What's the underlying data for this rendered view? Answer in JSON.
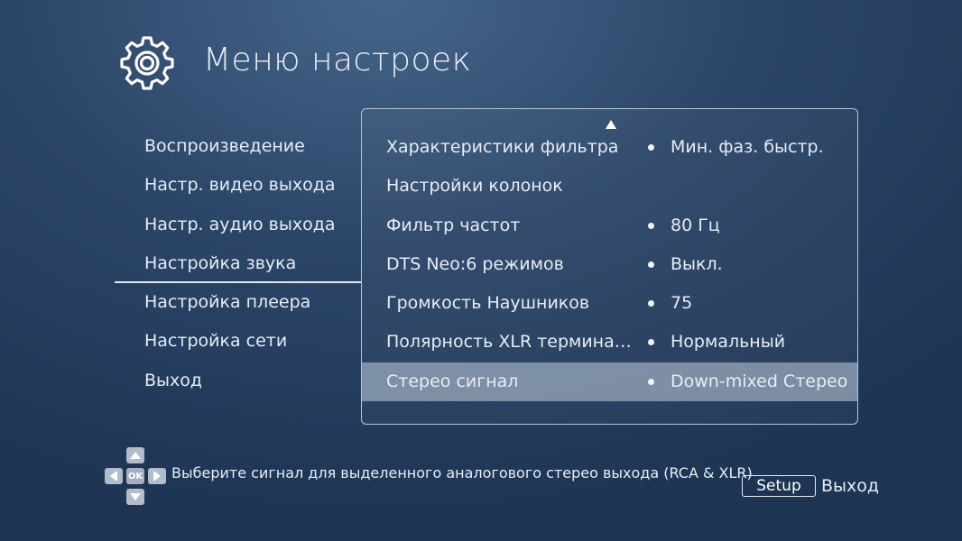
{
  "header": {
    "title": "Меню настроек",
    "icon": "gear-icon"
  },
  "sidebar": {
    "items": [
      {
        "label": "Воспроизведение"
      },
      {
        "label": "Настр. видео выхода"
      },
      {
        "label": "Настр. аудио выхода"
      },
      {
        "label": "Настройка звука"
      },
      {
        "label": "Настройка плеера"
      },
      {
        "label": "Настройка сети"
      },
      {
        "label": "Выход"
      }
    ],
    "active_index": 3
  },
  "panel": {
    "rows": [
      {
        "label": "Характеристики фильтра",
        "value": "Мин. фаз. быстр."
      },
      {
        "label": "Настройки колонок",
        "value": ""
      },
      {
        "label": "Фильтр частот",
        "value": "80 Гц"
      },
      {
        "label": "DTS Neo:6 режимов",
        "value": "Выкл."
      },
      {
        "label": "Громкость Наушников",
        "value": "75"
      },
      {
        "label": "Полярность XLR термина…",
        "value": "Нормальный"
      },
      {
        "label": "Стерео сигнал",
        "value": "Down-mixed Стерео"
      }
    ],
    "selected_index": 6
  },
  "footer": {
    "hint": "Выберите сигнал для выделенного аналогового стерео выхода (RCA & XLR)",
    "ok_label": "OK",
    "setup_label": "Setup",
    "exit_label": "Выход"
  },
  "colors": {
    "background": "#2c4668",
    "selected_row": "#9fb0c6",
    "text": "#e6edf5"
  }
}
